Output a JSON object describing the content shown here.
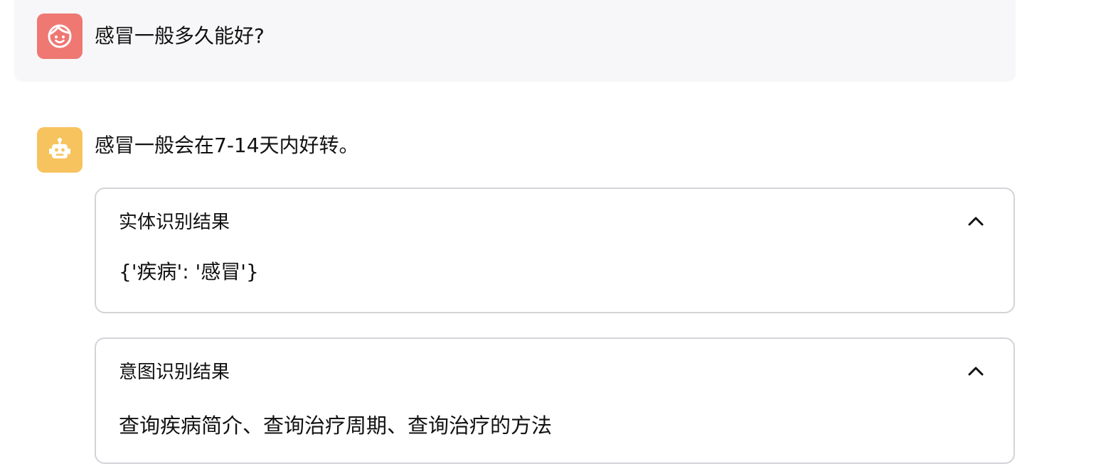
{
  "conversation": {
    "user_message": {
      "avatar_icon": "face-icon",
      "avatar_color": "#ef7873",
      "text": "感冒一般多久能好?"
    },
    "bot_message": {
      "avatar_icon": "robot-icon",
      "avatar_color": "#f6c35f",
      "text": "感冒一般会在7-14天内好转。"
    }
  },
  "expanders": {
    "entity": {
      "title": "实体识别结果",
      "content": "{'疾病': '感冒'}",
      "toggle_icon": "chevron-up-icon",
      "expanded": true
    },
    "intent": {
      "title": "意图识别结果",
      "content": "查询疾病简介、查询治疗周期、查询治疗的方法",
      "toggle_icon": "chevron-up-icon",
      "expanded": true
    }
  }
}
